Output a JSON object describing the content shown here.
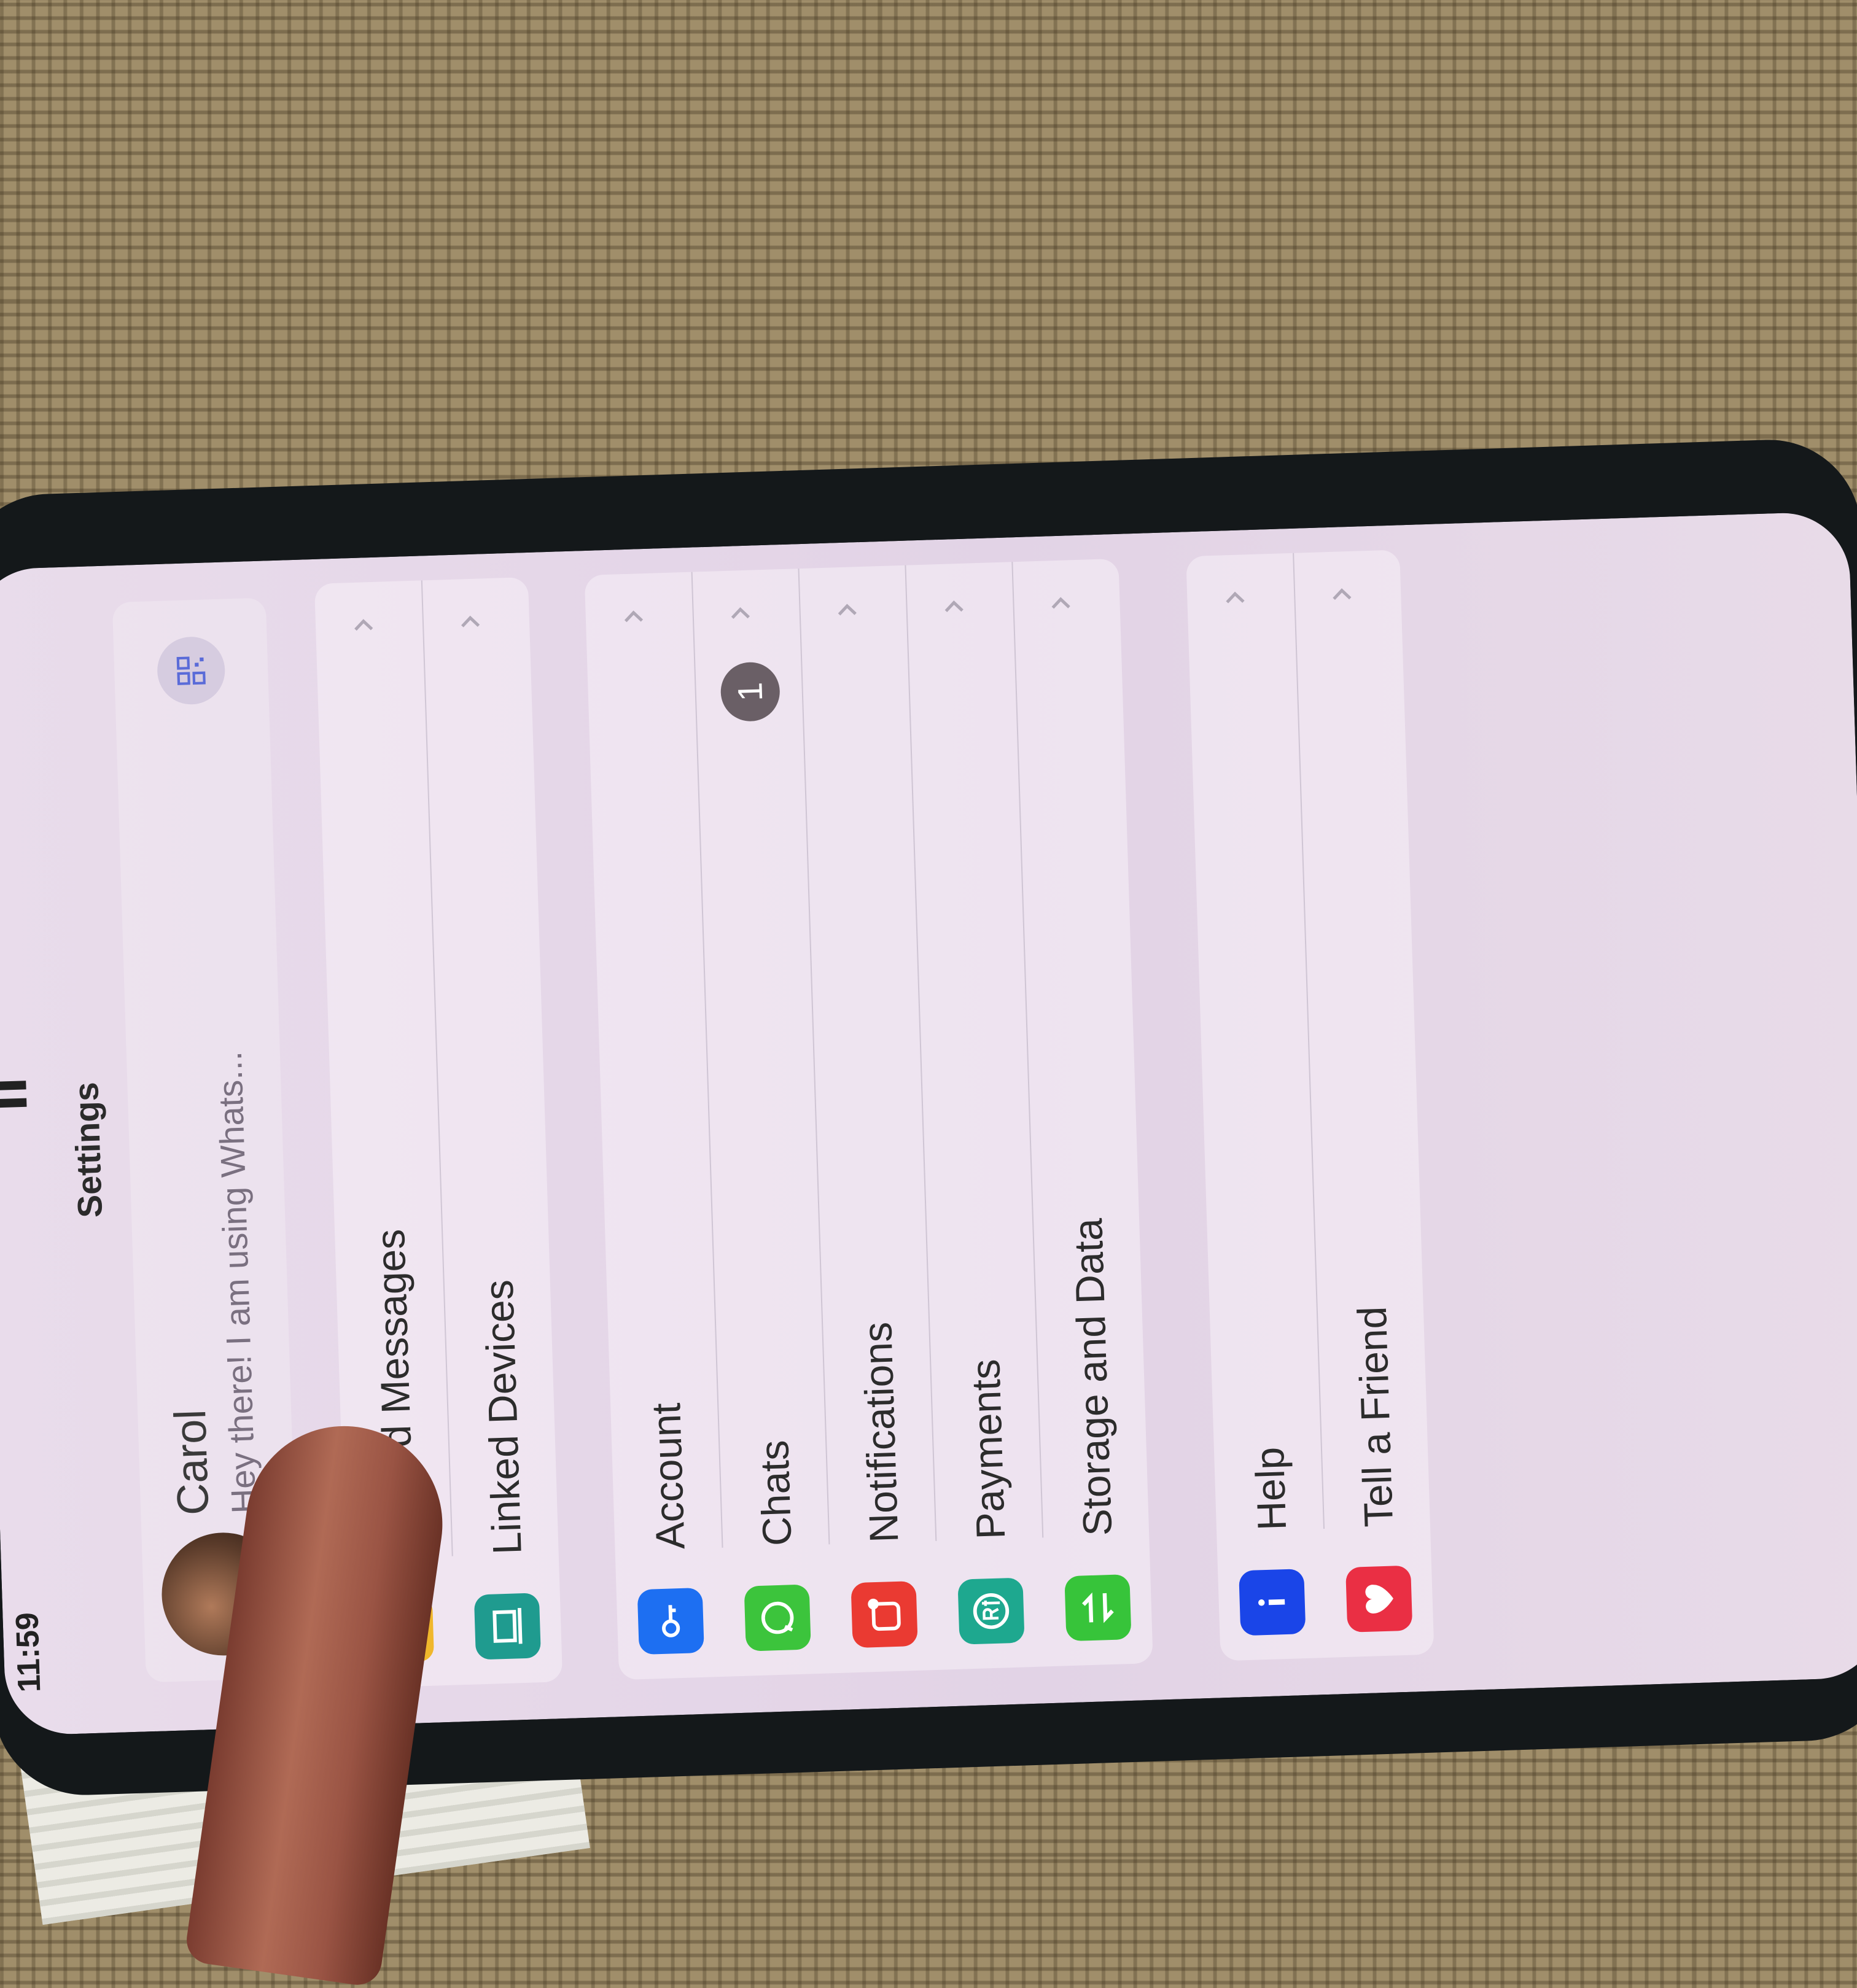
{
  "status_bar": {
    "time": "11:59",
    "signal": "▌▌"
  },
  "nav": {
    "title": "Settings"
  },
  "profile": {
    "name": "Carol",
    "status": "Hey there! I am using Whats..."
  },
  "groups": [
    {
      "items": [
        {
          "label": "Starred Messages",
          "icon": "star-icon",
          "color": "#f0b72c"
        },
        {
          "label": "Linked Devices",
          "icon": "laptop-icon",
          "color": "#1f9b8f"
        }
      ]
    },
    {
      "items": [
        {
          "label": "Account",
          "icon": "key-icon",
          "color": "#1d6ff2"
        },
        {
          "label": "Chats",
          "icon": "whatsapp-icon",
          "color": "#3cc43c",
          "badge": "1"
        },
        {
          "label": "Notifications",
          "icon": "notification-icon",
          "color": "#ea3a32"
        },
        {
          "label": "Payments",
          "icon": "payments-icon",
          "color": "#1ea88f"
        },
        {
          "label": "Storage and Data",
          "icon": "arrows-icon",
          "color": "#37c43a"
        }
      ]
    },
    {
      "items": [
        {
          "label": "Help",
          "icon": "info-icon",
          "color": "#1a45e8"
        },
        {
          "label": "Tell a Friend",
          "icon": "heart-icon",
          "color": "#ea2f44"
        }
      ]
    }
  ],
  "accent": "#25d366"
}
